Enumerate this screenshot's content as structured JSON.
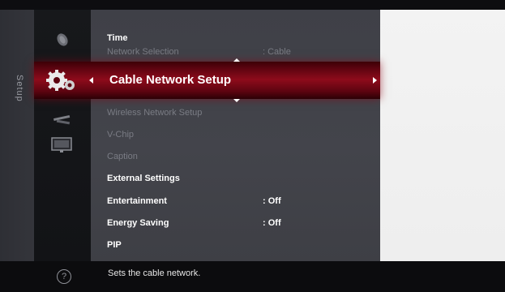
{
  "sidebar": {
    "category_label": "Setup"
  },
  "icons": [
    {
      "name": "satellite-dish-icon",
      "selected": false
    },
    {
      "name": "gear-icon",
      "selected": true
    },
    {
      "name": "tools-icon",
      "selected": false
    },
    {
      "name": "monitor-icon",
      "selected": false
    }
  ],
  "menu": {
    "items": [
      {
        "label": "Time",
        "value": "",
        "enabled": true
      },
      {
        "label": "Network Selection",
        "value": ": Cable",
        "enabled": false
      },
      {
        "label": "Wireless Network Setup",
        "value": "",
        "enabled": false
      },
      {
        "label": "V-Chip",
        "value": "",
        "enabled": false
      },
      {
        "label": "Caption",
        "value": "",
        "enabled": false
      },
      {
        "label": "External Settings",
        "value": "",
        "enabled": true
      },
      {
        "label": "Entertainment",
        "value": ": Off",
        "enabled": true
      },
      {
        "label": "Energy Saving",
        "value": ": Off",
        "enabled": true
      },
      {
        "label": "PIP",
        "value": "",
        "enabled": true
      }
    ],
    "selected_label": "Cable Network Setup"
  },
  "footer": {
    "help_glyph": "?",
    "help_text": "Sets the cable network."
  },
  "colors": {
    "highlight": "#8e0b1b",
    "menu_bg": "#42434a",
    "dim_text": "#7a7c84"
  }
}
